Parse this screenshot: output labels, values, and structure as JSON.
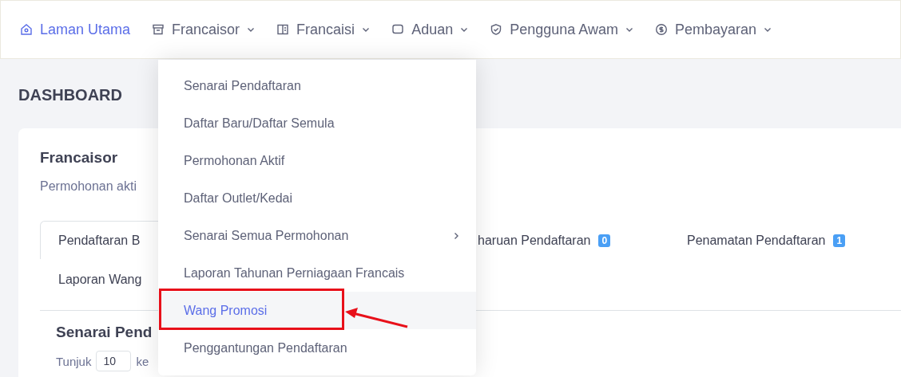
{
  "nav": [
    {
      "label": "Laman Utama",
      "selected": true,
      "dropdown": false
    },
    {
      "label": "Francaisor",
      "selected": false,
      "dropdown": true
    },
    {
      "label": "Francaisi",
      "selected": false,
      "dropdown": true
    },
    {
      "label": "Aduan",
      "selected": false,
      "dropdown": true
    },
    {
      "label": "Pengguna Awam",
      "selected": false,
      "dropdown": true
    },
    {
      "label": "Pembayaran",
      "selected": false,
      "dropdown": true
    }
  ],
  "page_title": "DASHBOARD",
  "card": {
    "title": "Francaisor",
    "subtitle": "Permohonan akti",
    "tabs": [
      {
        "label": "Pendaftaran B",
        "selected": true
      },
      {
        "label": "haruan Pendaftaran",
        "badge": "0",
        "selected": false
      },
      {
        "label": "Penamatan Pendaftaran",
        "badge": "1",
        "selected": false
      },
      {
        "label": "Laporan Wang",
        "selected": false
      }
    ],
    "section_title": "Senarai Pend",
    "length": {
      "label": "Tunjuk",
      "value": "10",
      "suffix": "ke"
    }
  },
  "menu": [
    {
      "label": "Senarai Pendaftaran",
      "selected": false,
      "submenu": false
    },
    {
      "label": "Daftar Baru/Daftar Semula",
      "selected": false,
      "submenu": false
    },
    {
      "label": "Permohonan Aktif",
      "selected": false,
      "submenu": false
    },
    {
      "label": "Daftar Outlet/Kedai",
      "selected": false,
      "submenu": false
    },
    {
      "label": "Senarai Semua Permohonan",
      "selected": false,
      "submenu": true
    },
    {
      "label": "Laporan Tahunan Perniagaan Francais",
      "selected": false,
      "submenu": false
    },
    {
      "label": "Wang Promosi",
      "selected": true,
      "submenu": false
    },
    {
      "label": "Penggantungan Pendaftaran",
      "selected": false,
      "submenu": false
    }
  ]
}
